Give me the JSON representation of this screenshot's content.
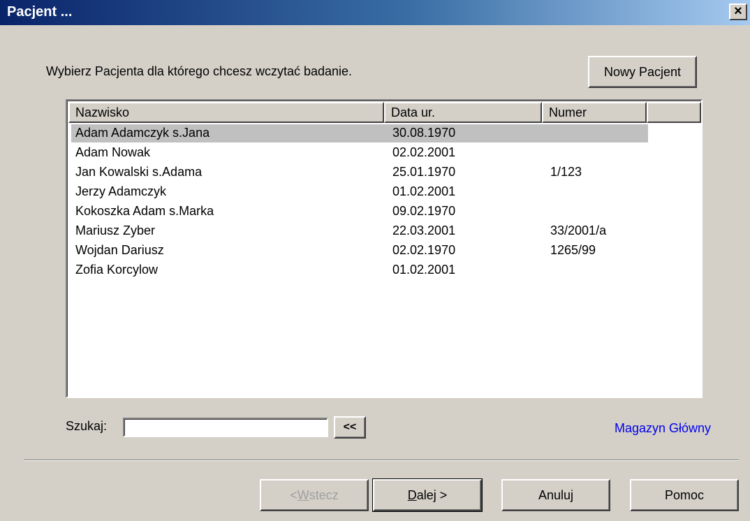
{
  "window": {
    "title": "Pacjent ...",
    "close_label": "×"
  },
  "instruction": "Wybierz Pacjenta dla którego chcesz wczytać badanie.",
  "new_patient_button": "Nowy Pacjent",
  "table": {
    "columns": [
      "Nazwisko",
      "Data ur.",
      "Numer",
      ""
    ],
    "rows": [
      {
        "name": "Adam Adamczyk s.Jana",
        "dob": "30.08.1970",
        "number": ""
      },
      {
        "name": "Adam Nowak",
        "dob": "02.02.2001",
        "number": ""
      },
      {
        "name": "Jan Kowalski s.Adama",
        "dob": "25.01.1970",
        "number": "1/123"
      },
      {
        "name": "Jerzy Adamczyk",
        "dob": "01.02.2001",
        "number": ""
      },
      {
        "name": "Kokoszka Adam s.Marka",
        "dob": "09.02.1970",
        "number": ""
      },
      {
        "name": "Mariusz Zyber",
        "dob": "22.03.2001",
        "number": "33/2001/a"
      },
      {
        "name": "Wojdan Dariusz",
        "dob": "02.02.1970",
        "number": "1265/99"
      },
      {
        "name": "Zofia Korcylow",
        "dob": "01.02.2001",
        "number": ""
      }
    ]
  },
  "search": {
    "label": "Szukaj:",
    "value": "",
    "back_label": "<<"
  },
  "link": "Magazyn Główny",
  "buttons": {
    "back_prefix": "< ",
    "back_accel": "W",
    "back_rest": "stecz",
    "next_accel": "D",
    "next_rest": "alej >",
    "cancel": "Anuluj",
    "help": "Pomoc"
  }
}
